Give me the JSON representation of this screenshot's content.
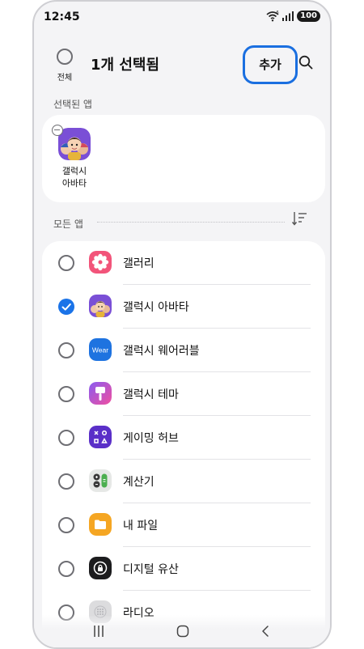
{
  "status_bar": {
    "time": "12:45",
    "wifi_badge": "6",
    "battery": "100"
  },
  "header": {
    "select_all_label": "전체",
    "title": "1개 선택됨",
    "add_label": "추가",
    "accent_color": "#1a6fe0"
  },
  "selected_section": {
    "label": "선택된 앱",
    "apps": [
      {
        "name": "갤럭시\n아바타",
        "icon": "galaxy-avatar-icon"
      }
    ]
  },
  "all_apps_section": {
    "label": "모든 앱",
    "sort_icon": "sort-icon"
  },
  "apps": [
    {
      "name": "갤러리",
      "icon": "gallery-icon",
      "checked": false
    },
    {
      "name": "갤럭시 아바타",
      "icon": "galaxy-avatar-icon",
      "checked": true
    },
    {
      "name": "갤럭시 웨어러블",
      "icon": "wear-icon",
      "icon_text": "Wear",
      "checked": false
    },
    {
      "name": "갤럭시 테마",
      "icon": "theme-icon",
      "checked": false
    },
    {
      "name": "게이밍 허브",
      "icon": "gaming-hub-icon",
      "checked": false
    },
    {
      "name": "계산기",
      "icon": "calculator-icon",
      "checked": false
    },
    {
      "name": "내 파일",
      "icon": "my-files-icon",
      "checked": false
    },
    {
      "name": "디지털 유산",
      "icon": "digital-legacy-icon",
      "checked": false
    },
    {
      "name": "라디오",
      "icon": "radio-icon",
      "checked": false
    }
  ],
  "nav": {
    "recent_icon": "recent-apps-icon",
    "home_icon": "home-icon",
    "back_icon": "back-icon"
  }
}
